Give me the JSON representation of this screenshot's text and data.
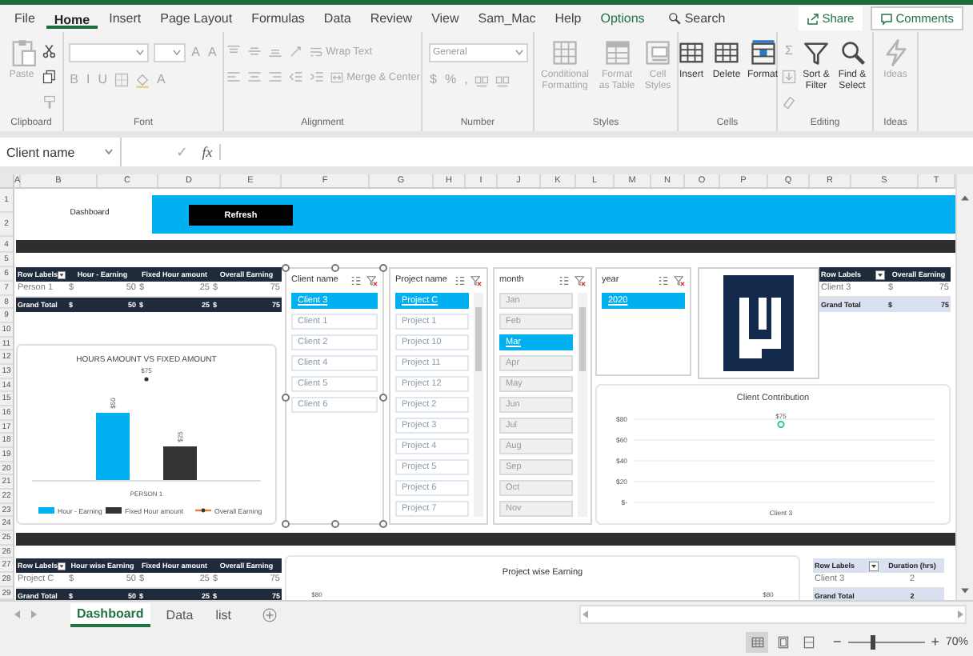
{
  "ribbon_tabs": [
    {
      "label": "File",
      "selected": false,
      "kind": "tab"
    },
    {
      "label": "Home",
      "selected": true,
      "kind": "tab"
    },
    {
      "label": "Insert",
      "selected": false,
      "kind": "tab"
    },
    {
      "label": "Page Layout",
      "selected": false,
      "kind": "tab"
    },
    {
      "label": "Formulas",
      "selected": false,
      "kind": "tab"
    },
    {
      "label": "Data",
      "selected": false,
      "kind": "tab"
    },
    {
      "label": "Review",
      "selected": false,
      "kind": "tab"
    },
    {
      "label": "View",
      "selected": false,
      "kind": "tab"
    },
    {
      "label": "Sam_Mac",
      "selected": false,
      "kind": "tab"
    },
    {
      "label": "Help",
      "selected": false,
      "kind": "tab"
    },
    {
      "label": "Options",
      "selected": false,
      "kind": "contextual"
    }
  ],
  "search": {
    "placeholder": "Search"
  },
  "share": "Share",
  "comments": "Comments",
  "ribbon_groups": [
    {
      "label": "Clipboard",
      "items": [
        {
          "kind": "big",
          "label": "Paste",
          "disabled": true
        },
        {
          "kind": "stack",
          "items": [
            {
              "kind": "icon",
              "disabled": false
            },
            {
              "kind": "icon",
              "disabled": false
            },
            {
              "kind": "icon",
              "disabled": true
            }
          ]
        }
      ]
    },
    {
      "label": "Font",
      "items": [
        {
          "kind": "stack",
          "items": [
            {
              "kind": "row",
              "items": [
                {
                  "kind": "field",
                  "disabled": true
                },
                {
                  "kind": "field",
                  "disabled": true
                },
                {
                  "kind": "glyph",
                  "label": "A",
                  "disabled": true
                },
                {
                  "kind": "glyph",
                  "label": "A",
                  "disabled": true
                }
              ]
            },
            {
              "kind": "row",
              "items": [
                {
                  "kind": "glyph",
                  "label": "B",
                  "disabled": true
                },
                {
                  "kind": "glyph",
                  "label": "I",
                  "disabled": true
                },
                {
                  "kind": "glyph",
                  "label": "U",
                  "disabled": true
                },
                {
                  "kind": "icon",
                  "disabled": true
                },
                {
                  "kind": "icon",
                  "disabled": true
                },
                {
                  "kind": "glyph",
                  "label": "A",
                  "disabled": true
                }
              ]
            }
          ]
        }
      ]
    },
    {
      "label": "Alignment",
      "items": [
        {
          "kind": "stack",
          "items": [
            {
              "kind": "row",
              "items": [
                {
                  "kind": "icon",
                  "disabled": true
                },
                {
                  "kind": "icon",
                  "disabled": true
                },
                {
                  "kind": "icon",
                  "disabled": true
                },
                {
                  "kind": "icon",
                  "disabled": true
                },
                {
                  "kind": "small",
                  "label": "Wrap Text",
                  "disabled": true
                }
              ]
            },
            {
              "kind": "row",
              "items": [
                {
                  "kind": "icon",
                  "disabled": true
                },
                {
                  "kind": "icon",
                  "disabled": true
                },
                {
                  "kind": "icon",
                  "disabled": true
                },
                {
                  "kind": "icon",
                  "disabled": true
                },
                {
                  "kind": "icon",
                  "disabled": true
                },
                {
                  "kind": "small",
                  "label": "Merge & Center",
                  "disabled": true
                }
              ]
            }
          ]
        }
      ]
    },
    {
      "label": "Number",
      "items": [
        {
          "kind": "stack",
          "items": [
            {
              "kind": "row",
              "items": [
                {
                  "kind": "field",
                  "value": "General",
                  "disabled": true
                }
              ]
            },
            {
              "kind": "row",
              "items": [
                {
                  "kind": "glyph",
                  "label": "$",
                  "disabled": true
                },
                {
                  "kind": "glyph",
                  "label": "%",
                  "disabled": true
                },
                {
                  "kind": "glyph",
                  "label": ",",
                  "disabled": true
                },
                {
                  "kind": "icon",
                  "disabled": true
                },
                {
                  "kind": "icon",
                  "disabled": true
                }
              ]
            }
          ]
        }
      ]
    },
    {
      "label": "Styles",
      "items": [
        {
          "kind": "big",
          "label": "Conditional Formatting",
          "disabled": true
        },
        {
          "kind": "big",
          "label": "Format as Table",
          "disabled": true
        },
        {
          "kind": "big",
          "label": "Cell Styles",
          "disabled": true
        }
      ]
    },
    {
      "label": "Cells",
      "items": [
        {
          "kind": "big",
          "label": "Insert",
          "disabled": false
        },
        {
          "kind": "big",
          "label": "Delete",
          "disabled": false
        },
        {
          "kind": "big",
          "label": "Format",
          "disabled": false
        }
      ]
    },
    {
      "label": "Editing",
      "items": [
        {
          "kind": "stack",
          "items": [
            {
              "kind": "glyph",
              "label": "Σ",
              "disabled": true
            },
            {
              "kind": "icon",
              "disabled": true
            },
            {
              "kind": "icon",
              "disabled": true
            }
          ]
        },
        {
          "kind": "big",
          "label": "Sort & Filter",
          "disabled": false
        },
        {
          "kind": "big",
          "label": "Find & Select",
          "disabled": false
        }
      ]
    },
    {
      "label": "Ideas",
      "items": [
        {
          "kind": "big",
          "label": "Ideas",
          "disabled": true
        }
      ]
    }
  ],
  "formula_bar": {
    "name_box": "Client name",
    "confirm": "✓",
    "function": "fx"
  },
  "sheet": {
    "columns": [
      "A",
      "B",
      "C",
      "D",
      "E",
      "F",
      "G",
      "H",
      "I",
      "J",
      "K",
      "L",
      "M",
      "N",
      "O",
      "P",
      "Q",
      "R",
      "S",
      "T"
    ],
    "rows": [
      "1",
      "2",
      "4",
      "5",
      "6",
      "7",
      "8",
      "9",
      "10",
      "11",
      "12",
      "13",
      "14",
      "15",
      "16",
      "17",
      "18",
      "19",
      "20",
      "21",
      "22",
      "23",
      "24",
      "25",
      "26",
      "27",
      "28",
      "29"
    ],
    "title": "Dashboard",
    "refresh_button": "Refresh",
    "pivots": [
      {
        "dark_header": true,
        "dark_total": true,
        "columns": [
          "Row Labels",
          "Hour - Earning",
          "Fixed Hour amount",
          "Overall Earning"
        ],
        "rows": [
          {
            "kind": "row",
            "cells": [
              {
                "value": "Person 1"
              },
              {
                "unit": "$",
                "value": "50"
              },
              {
                "unit": "$",
                "value": "25"
              },
              {
                "unit": "$",
                "value": "75"
              }
            ]
          },
          {
            "kind": "total",
            "cells": [
              {
                "value": "Grand Total"
              },
              {
                "unit": "$",
                "value": "50"
              },
              {
                "unit": "$",
                "value": "25"
              },
              {
                "unit": "$",
                "value": "75"
              }
            ]
          }
        ]
      },
      {
        "dark_header": true,
        "dark_total": false,
        "columns": [
          "Row Labels",
          "Overall Earning"
        ],
        "rows": [
          {
            "kind": "row",
            "cells": [
              {
                "value": "Client 3"
              },
              {
                "unit": "$",
                "value": "75"
              }
            ]
          },
          {
            "kind": "total",
            "cells": [
              {
                "value": "Grand Total"
              },
              {
                "unit": "$",
                "value": "75"
              }
            ]
          }
        ]
      },
      {
        "dark_header": true,
        "dark_total": true,
        "columns": [
          "Row Labels",
          "Hour wise Earning",
          "Fixed Hour amount",
          "Overall Earning"
        ],
        "rows": [
          {
            "kind": "row",
            "cells": [
              {
                "value": "Project C"
              },
              {
                "unit": "$",
                "value": "50"
              },
              {
                "unit": "$",
                "value": "25"
              },
              {
                "unit": "$",
                "value": "75"
              }
            ]
          },
          {
            "kind": "total",
            "cells": [
              {
                "value": "Grand Total"
              },
              {
                "unit": "$",
                "value": "50"
              },
              {
                "unit": "$",
                "value": "25"
              },
              {
                "unit": "$",
                "value": "75"
              }
            ]
          }
        ]
      },
      {
        "dark_header": false,
        "dark_total": false,
        "columns": [
          "Row Labels",
          "Duration (hrs)"
        ],
        "rows": [
          {
            "kind": "row",
            "cells": [
              {
                "value": "Client 3"
              },
              {
                "value": "2"
              }
            ]
          },
          {
            "kind": "total",
            "cells": [
              {
                "value": "Grand Total"
              },
              {
                "value": "2"
              }
            ]
          }
        ]
      }
    ],
    "slicers": [
      {
        "title": "Client name",
        "selected": true,
        "scrollbar": false,
        "items": [
          {
            "label": "Client 3",
            "selected": true,
            "available": true
          },
          {
            "label": "Client 1",
            "selected": false,
            "available": true
          },
          {
            "label": "Client 2",
            "selected": false,
            "available": true
          },
          {
            "label": "Client 4",
            "selected": false,
            "available": true
          },
          {
            "label": "Client 5",
            "selected": false,
            "available": true
          },
          {
            "label": "Client 6",
            "selected": false,
            "available": true
          }
        ]
      },
      {
        "title": "Project name",
        "selected": false,
        "scrollbar": true,
        "items": [
          {
            "label": "Project C",
            "selected": true,
            "available": true
          },
          {
            "label": "Project 1",
            "selected": false,
            "available": true
          },
          {
            "label": "Project 10",
            "selected": false,
            "available": true
          },
          {
            "label": "Project 11",
            "selected": false,
            "available": true
          },
          {
            "label": "Project 12",
            "selected": false,
            "available": true
          },
          {
            "label": "Project 2",
            "selected": false,
            "available": true
          },
          {
            "label": "Project 3",
            "selected": false,
            "available": true
          },
          {
            "label": "Project 4",
            "selected": false,
            "available": true
          },
          {
            "label": "Project 5",
            "selected": false,
            "available": true
          },
          {
            "label": "Project 6",
            "selected": false,
            "available": true
          },
          {
            "label": "Project 7",
            "selected": false,
            "available": true
          }
        ]
      },
      {
        "title": "month",
        "selected": false,
        "scrollbar": true,
        "items": [
          {
            "label": "Jan",
            "selected": false,
            "available": false
          },
          {
            "label": "Feb",
            "selected": false,
            "available": false
          },
          {
            "label": "Mar",
            "selected": true,
            "available": true
          },
          {
            "label": "Apr",
            "selected": false,
            "available": false
          },
          {
            "label": "May",
            "selected": false,
            "available": false
          },
          {
            "label": "Jun",
            "selected": false,
            "available": false
          },
          {
            "label": "Jul",
            "selected": false,
            "available": false
          },
          {
            "label": "Aug",
            "selected": false,
            "available": false
          },
          {
            "label": "Sep",
            "selected": false,
            "available": false
          },
          {
            "label": "Oct",
            "selected": false,
            "available": false
          },
          {
            "label": "Nov",
            "selected": false,
            "available": false
          }
        ]
      },
      {
        "title": "year",
        "selected": false,
        "scrollbar": false,
        "items": [
          {
            "label": "2020",
            "selected": true,
            "available": true
          }
        ]
      }
    ],
    "charts": [
      {
        "kind": "combo",
        "title": "HOURS AMOUNT VS FIXED AMOUNT",
        "category": "PERSON 1",
        "series": [
          {
            "name": "Hour - Earning",
            "color": "#00b0f0",
            "label": "$50"
          },
          {
            "name": "Fixed Hour amount",
            "color": "#333333",
            "label": "$25"
          },
          {
            "name": "Overall Earning",
            "color": "#ed7d31",
            "label": "$75"
          }
        ]
      },
      {
        "chart_data": {
          "type": "line",
          "title": "Client Contribution",
          "categories": [
            "Client 3"
          ],
          "series": [
            {
              "color": "#3fbfa0",
              "values": [
                75
              ],
              "marker": true
            }
          ],
          "grid": true,
          "ylim": [
            0,
            80
          ],
          "yticks": [
            {
              "value": 0,
              "label": "$-"
            },
            {
              "value": 20,
              "label": "$20"
            },
            {
              "value": 40,
              "label": "$40"
            },
            {
              "value": 60,
              "label": "$60"
            },
            {
              "value": 80,
              "label": "$80"
            }
          ],
          "value_labels": [
            "$75"
          ]
        }
      },
      {
        "title": "Project wise Earning",
        "axis_labels": [
          "$80",
          "$80"
        ]
      }
    ]
  },
  "sheet_tabs": [
    {
      "label": "Dashboard",
      "selected": true
    },
    {
      "label": "Data",
      "selected": false
    },
    {
      "label": "list",
      "selected": false
    }
  ],
  "status_bar": {
    "views": [
      {
        "selected": true
      },
      {
        "selected": false
      },
      {
        "selected": false
      }
    ],
    "zoom_out": "−",
    "zoom_in": "+",
    "zoom": {
      "level": 0.31
    },
    "zoom_reading": "70%"
  }
}
